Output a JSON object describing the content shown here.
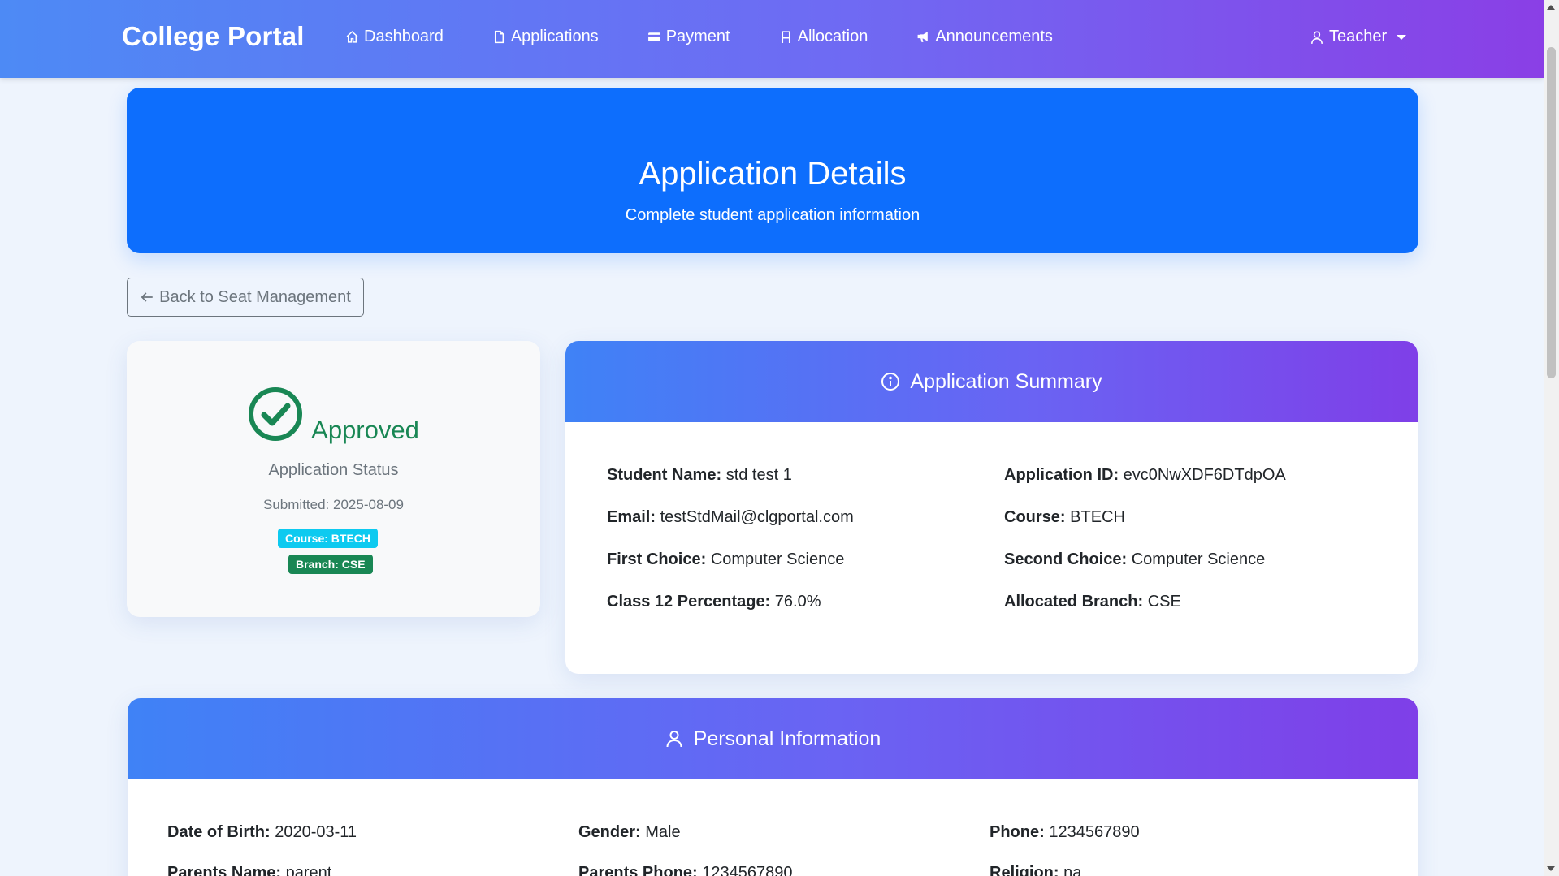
{
  "navbar": {
    "brand": "College Portal",
    "links": [
      {
        "label": "Dashboard",
        "icon": "home-icon"
      },
      {
        "label": "Applications",
        "icon": "document-icon"
      },
      {
        "label": "Payment",
        "icon": "credit-card-icon"
      },
      {
        "label": "Allocation",
        "icon": "chair-icon"
      },
      {
        "label": "Announcements",
        "icon": "megaphone-icon"
      }
    ],
    "user": {
      "label": "Teacher",
      "icon": "user-icon"
    }
  },
  "hero": {
    "title": "Application Details",
    "subtitle": "Complete student application information"
  },
  "back_button": "Back to Seat Management",
  "status": {
    "value": "Approved",
    "label": "Application Status",
    "submitted": "Submitted: 2025-08-09",
    "course_badge": "Course: BTECH",
    "branch_badge": "Branch: CSE",
    "color": "#198754"
  },
  "summary": {
    "title": "Application Summary",
    "fields": {
      "student_name": {
        "label": "Student Name:",
        "value": "std test 1"
      },
      "application_id": {
        "label": "Application ID:",
        "value": "evc0NwXDF6DTdpOA"
      },
      "email": {
        "label": "Email:",
        "value": "testStdMail@clgportal.com"
      },
      "course": {
        "label": "Course:",
        "value": "BTECH"
      },
      "first_choice": {
        "label": "First Choice:",
        "value": "Computer Science"
      },
      "second_choice": {
        "label": "Second Choice:",
        "value": "Computer Science"
      },
      "class12": {
        "label": "Class 12 Percentage:",
        "value": "76.0%"
      },
      "allocated_branch": {
        "label": "Allocated Branch:",
        "value": "CSE"
      }
    }
  },
  "personal": {
    "title": "Personal Information",
    "fields": {
      "dob": {
        "label": "Date of Birth:",
        "value": "2020-03-11"
      },
      "gender": {
        "label": "Gender:",
        "value": "Male"
      },
      "phone": {
        "label": "Phone:",
        "value": "1234567890"
      },
      "parents_name": {
        "label": "Parents Name:",
        "value": "parent"
      },
      "parents_phone": {
        "label": "Parents Phone:",
        "value": "1234567890"
      },
      "religion": {
        "label": "Religion:",
        "value": "na"
      }
    }
  },
  "colors": {
    "primary": "#0d6efd",
    "gradient_start": "#4d8af5",
    "gradient_end": "#8a3fe6",
    "success": "#198754",
    "info": "#0dcaf0"
  }
}
